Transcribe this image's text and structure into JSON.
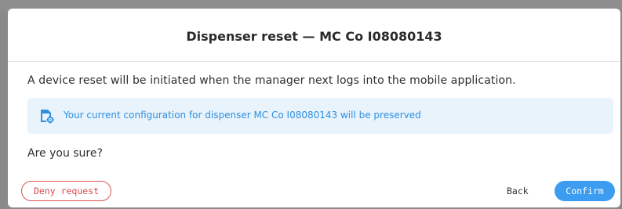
{
  "dialog": {
    "title": "Dispenser reset — MC Co I08080143",
    "message": "A device reset will be initiated when the manager next logs into the mobile application.",
    "info": {
      "icon": "device-settings-icon",
      "text": "Your current configuration for dispenser MC Co I08080143 will be preserved"
    },
    "question": "Are you sure?",
    "buttons": {
      "deny": "Deny request",
      "back": "Back",
      "confirm": "Confirm"
    }
  },
  "colors": {
    "accent": "#3b9cf0",
    "danger": "#e05252",
    "info_background": "#e8f3fc",
    "info_text": "#2f8fe0"
  }
}
